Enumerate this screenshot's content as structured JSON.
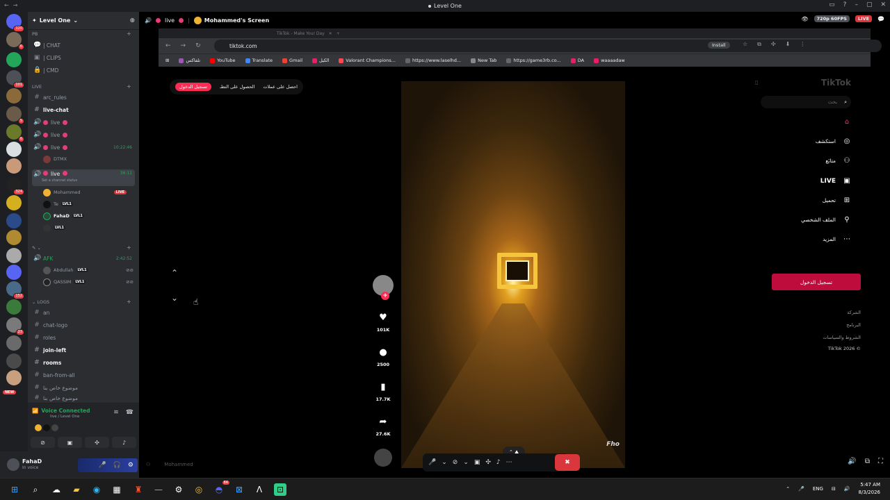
{
  "window": {
    "title": "Level One"
  },
  "rail": {
    "servers": [
      {
        "name": "s1",
        "badge": "120",
        "color": "#5865f2"
      },
      {
        "name": "s2",
        "badge": "6",
        "color": "#7a6a5a"
      },
      {
        "name": "s3",
        "badge": "",
        "color": "#23a55a"
      },
      {
        "name": "s4",
        "badge": "101",
        "color": "#4e5058"
      },
      {
        "name": "s5",
        "badge": "",
        "color": "#8a6a3a"
      },
      {
        "name": "s6",
        "badge": "5",
        "color": "#6a5a4a"
      },
      {
        "name": "s7",
        "badge": "6",
        "color": "#6b7a2a"
      },
      {
        "name": "s8",
        "badge": "",
        "color": "#dbdee1"
      },
      {
        "name": "s9",
        "badge": "",
        "color": "#c89a7a"
      },
      {
        "name": "s10",
        "badge": "324",
        "color": "#222"
      },
      {
        "name": "s11",
        "badge": "",
        "color": "#d4b020"
      },
      {
        "name": "s12",
        "badge": "",
        "color": "#2a4a8a"
      },
      {
        "name": "s13",
        "badge": "",
        "color": "#b08a30"
      },
      {
        "name": "s14",
        "badge": "",
        "color": "#aaaaaa"
      },
      {
        "name": "s15",
        "badge": "",
        "color": "#5865f2"
      },
      {
        "name": "s16",
        "badge": "152",
        "color": "#4a6a8a"
      },
      {
        "name": "s17",
        "badge": "",
        "color": "#3a7a3a"
      },
      {
        "name": "s18",
        "badge": "23",
        "color": "#7a7a7a"
      },
      {
        "name": "s19",
        "badge": "",
        "color": "#6a6a6a"
      },
      {
        "name": "s20",
        "badge": "",
        "color": "#4a4a4a"
      },
      {
        "name": "s21",
        "badge": "",
        "color": "#c8a080"
      }
    ],
    "new_label": "NEW"
  },
  "server": {
    "name": "Level One"
  },
  "categories": {
    "pb": "PB",
    "live": "LIVE",
    "logs": "Logs"
  },
  "channels": {
    "chat": "| CHAT",
    "clips": "| CLIPS",
    "cmd": "| CMD",
    "arc_rules": "arc_rules",
    "live_chat": "live-chat",
    "live1": "live",
    "live2": "live",
    "live3": "live",
    "live3_time": "10:22:46",
    "live3_user": "DTMX",
    "live4": "live",
    "live4_time": "36:11",
    "live4_sub": "Set a channel status",
    "afk": "AFK",
    "afk_time": "2:42:52",
    "an": "an",
    "chat_logo": "chat-logo",
    "roles": "roles",
    "join_left": "join-left",
    "rooms": "rooms",
    "ban_from_all": "ban-from-all",
    "topic1": "موضوع خاص بنا",
    "topic2": "موضوع خاص بنا"
  },
  "voice_users": {
    "mohammed": "Mohammed",
    "live_tag": "LIVE",
    "u2": "Te",
    "fahad": "FahaD",
    "lvl": "LVL1",
    "abdullah": "Abdullah",
    "qassim": "QASSIM"
  },
  "voice_panel": {
    "status": "Voice Connected",
    "sub": "live / Level One"
  },
  "user": {
    "name": "FahaD",
    "status": "In voice"
  },
  "stream": {
    "channel": "live",
    "title": "Mohammed's Screen",
    "quality": "720p 60FPS",
    "live": "LIVE",
    "presenter": "Mohammed"
  },
  "browser": {
    "tab_title": "TikTok - Make Your Day",
    "url": "tiktok.com",
    "install": "Install",
    "bookmarks": [
      {
        "label": "تلفاكس"
      },
      {
        "label": "YouTube"
      },
      {
        "label": "Translate"
      },
      {
        "label": "Gmail"
      },
      {
        "label": "الكيل"
      },
      {
        "label": "Valorant Champions..."
      },
      {
        "label": "https://www.laselhd..."
      },
      {
        "label": "New Tab"
      },
      {
        "label": "https://game3rb.co..."
      },
      {
        "label": "DA"
      },
      {
        "label": "waaaadaw"
      }
    ]
  },
  "tiktok": {
    "logo": "TikTok",
    "search_placeholder": "بحث",
    "top_buttons": {
      "login": "تسجيل الدخول",
      "get_app": "الحصول على التطـ",
      "get_coins": "احصل على عملات"
    },
    "nav": [
      {
        "label": "",
        "icon": "home-icon"
      },
      {
        "label": "استكشف",
        "icon": "compass-icon"
      },
      {
        "label": "متابَع",
        "icon": "user-plus-icon"
      },
      {
        "label": "LIVE",
        "icon": "live-icon"
      },
      {
        "label": "تحميل",
        "icon": "upload-icon"
      },
      {
        "label": "الملف الشخصي",
        "icon": "profile-icon"
      },
      {
        "label": "المزيد",
        "icon": "more-icon"
      }
    ],
    "login_side": "تسجيل الدخول",
    "footer": [
      "الشركة",
      "البرنامج",
      "الشروط والسياسات",
      "TikTok 2026 ©"
    ],
    "video_watermark": "Fho",
    "actions": {
      "likes": "101K",
      "comments": "2500",
      "saves": "17.7K",
      "shares": "27.6K"
    }
  },
  "taskbar": {
    "lang": "ENG",
    "time": "5:47 AM",
    "date": "8/3/2026",
    "discord_badge": "84"
  }
}
